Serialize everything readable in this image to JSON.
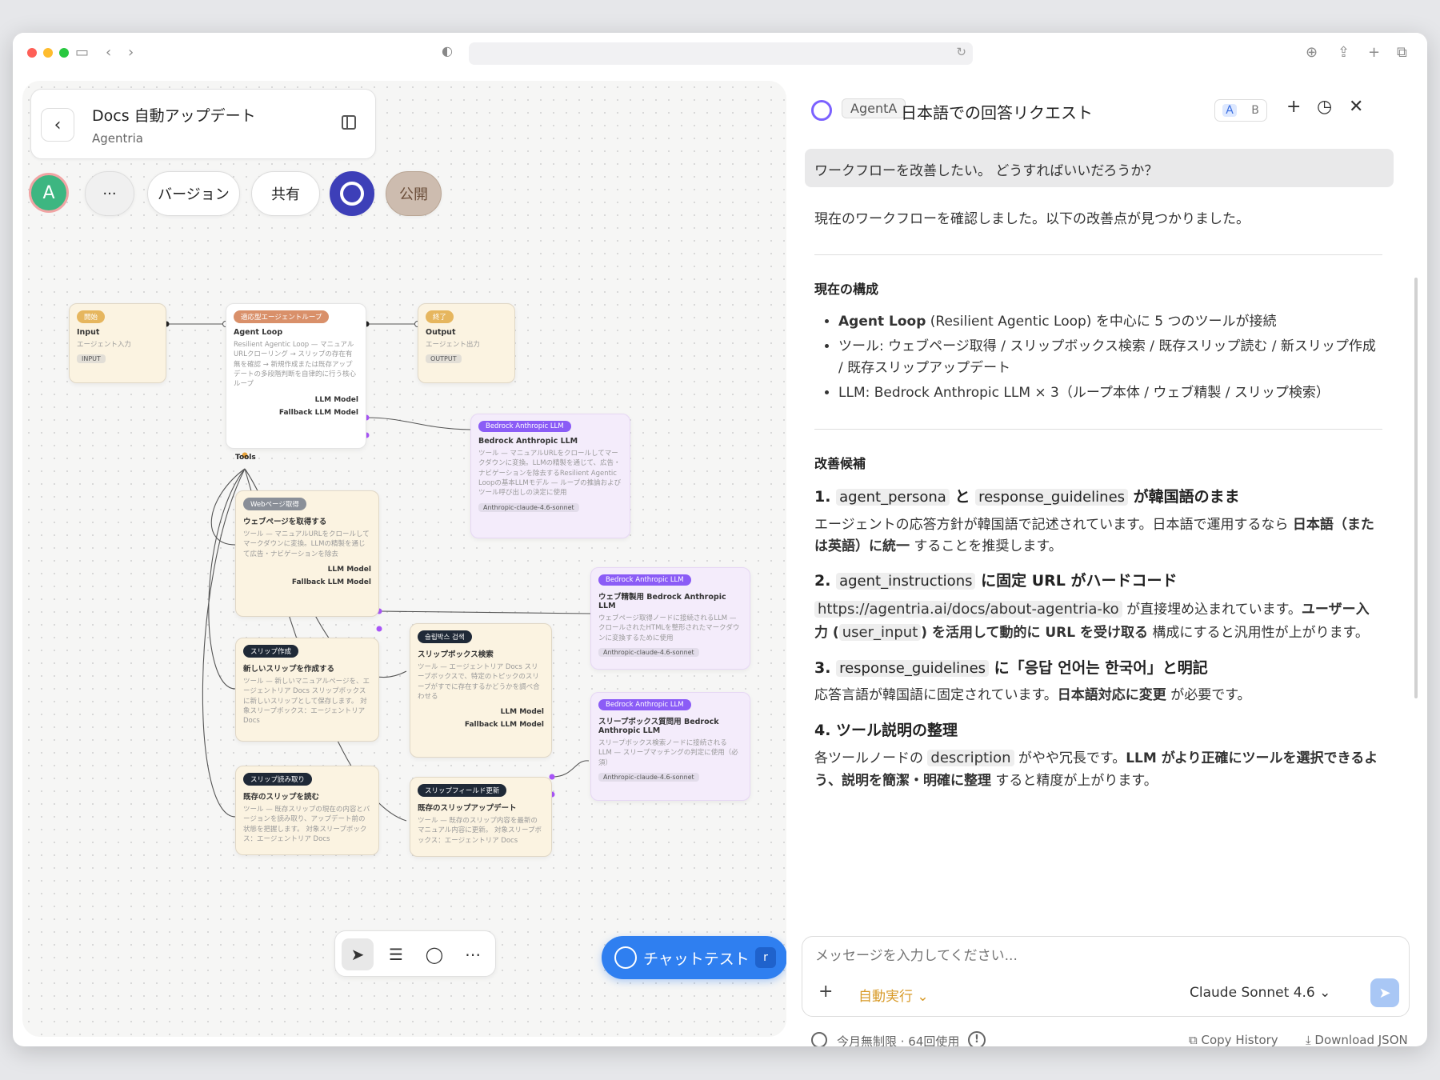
{
  "canvas": {
    "doc_title": "Docs 自動アップデート",
    "doc_subtitle": "Agentria",
    "avatar_letter": "A",
    "more_label": "···",
    "version_label": "バージョン",
    "share_label": "共有",
    "publish_label": "公開",
    "nodes": {
      "input": {
        "tag": "開始",
        "title": "Input",
        "desc": "エージェント入力",
        "badge": "INPUT"
      },
      "agent": {
        "tag": "適応型エージェントループ",
        "title": "Agent Loop",
        "desc": "Resilient Agentic Loop — マニュアルURLクローリング → スリップの存在有無を確認 → 新規作成または既存アップデートの多段階判断を自律的に行う核心ループ",
        "llm": "LLM Model",
        "fallback": "Fallback LLM Model",
        "tools": "Tools"
      },
      "output": {
        "tag": "終了",
        "title": "Output",
        "desc": "エージェント出力",
        "badge": "OUTPUT"
      },
      "llm1": {
        "tag": "Bedrock Anthropic LLM",
        "title": "Bedrock Anthropic LLM",
        "desc": "ツール — マニュアルURLをクロールしてマークダウンに変換。LLMの精製を通じて、広告・ナビゲーションを除去するResilient Agentic Loopの基本LLMモデル — ループの推論およびツール呼び出しの決定に使用",
        "badge": "Anthropic-claude-4.6-sonnet"
      },
      "web": {
        "tag": "Webページ取得",
        "title": "ウェブページを取得する",
        "desc": "ツール — マニュアルURLをクロールしてマークダウンに変換。LLMの精製を通じて広告・ナビゲーションを除去",
        "llm": "LLM Model",
        "fallback": "Fallback LLM Model"
      },
      "llm2": {
        "tag": "Bedrock Anthropic LLM",
        "title": "ウェブ精製用 Bedrock Anthropic LLM",
        "desc": "ウェブページ取得ノードに接続されるLLM — クロールされたHTMLを整形されたマークダウンに変換するために使用",
        "badge": "Anthropic-claude-4.6-sonnet"
      },
      "create": {
        "tag": "スリップ作成",
        "title": "新しいスリップを作成する",
        "desc": "ツール — 新しいマニュアルページを、エージェントリア Docs スリップボックスに新しいスリップとして保存します。 対象スリープボックス：エージェントリア Docs"
      },
      "search": {
        "tag": "슬립박스 검색",
        "title": "スリップボックス検索",
        "desc": "ツール — エージェントリア Docs スリープボックスで、特定のトピックのスリープがすでに存在するかどうかを調べ合わせる",
        "llm": "LLM Model",
        "fallback": "Fallback LLM Model"
      },
      "llm3": {
        "tag": "Bedrock Anthropic LLM",
        "title": "スリープボックス質問用 Bedrock Anthropic LLM",
        "desc": "スリープボックス検索ノードに接続される LLM — スリープマッチングの判定に使用（必須）",
        "badge": "Anthropic-claude-4.6-sonnet"
      },
      "read": {
        "tag": "スリップ読み取り",
        "title": "既存のスリップを読む",
        "desc": "ツール — 既存スリップの現在の内容とバージョンを読み取り、アップデート前の状態を把握します。 対象スリープボックス：エージェントリア Docs"
      },
      "update": {
        "tag": "スリップフィールド更新",
        "title": "既存のスリップアップデート",
        "desc": "ツール — 既存のスリップ内容を最新のマニュアル内容に更新。 対象スリープボックス：エージェントリア Docs"
      }
    },
    "chat_test_label": "チャットテスト",
    "chat_test_key": "r"
  },
  "chat": {
    "agent_chip": "AgentA",
    "title": "日本語での回答リクエスト",
    "ab_a": "A",
    "ab_b": "B",
    "user_message": "ワークフローを改善したい。 どうすればいいだろうか？",
    "intro": "現在のワークフローを確認しました。以下の改善点が見つかりました。",
    "section1_heading": "現在の構成",
    "bullet1_bold": "Agent Loop",
    "bullet1_rest": " (Resilient Agentic Loop) を中心に 5 つのツールが接続",
    "bullet2": "ツール: ウェブページ取得 / スリップボックス検索 / 既存スリップ読む / 新スリップ作成 / 既存スリップアップデート",
    "bullet3": "LLM: Bedrock Anthropic LLM × 3（ループ本体 / ウェブ精製 / スリップ検索）",
    "section2_heading": "改善候補",
    "item1": {
      "num": "1.",
      "code_a": "agent_persona",
      "mid": "と",
      "code_b": "response_guidelines",
      "tail": "が韓国語のまま",
      "body_a": "エージェントの応答方針が韓国語で記述されています。日本語で運用するなら ",
      "body_bold": "日本語（または英語）に統一",
      "body_b": " することを推奨します。"
    },
    "item2": {
      "num": "2.",
      "code": "agent_instructions",
      "tail": "に固定 URL がハードコード",
      "url": "https://agentria.ai/docs/about-agentria-ko",
      "body_a": " が直接埋め込まれています。",
      "body_bold_a": "ユーザー入力 (",
      "code_in": "user_input",
      "body_bold_b": ") を活用して動的に URL を受け取る",
      "body_b": " 構成にすると汎用性が上がります。"
    },
    "item3": {
      "num": "3.",
      "code": "response_guidelines",
      "tail": "に「응답 언어는 한국어」と明記",
      "body_a": "応答言語が韓国語に固定されています。",
      "body_bold": "日本語対応に変更",
      "body_b": " が必要です。"
    },
    "item4": {
      "heading": "4. ツール説明の整理",
      "body_a": "各ツールノードの ",
      "code": "description",
      "body_b": " がやや冗長です。",
      "body_bold": "LLM がより正確にツールを選択できるよう、説明を簡潔・明確に整理",
      "body_c": " すると精度が上がります。"
    },
    "input_placeholder": "メッセージを入力してください...",
    "auto_run_label": "自動実行",
    "model_label": "Claude Sonnet 4.6",
    "usage_label": "今月無制限 · 64回使用",
    "copy_history_label": "Copy History",
    "download_json_label": "Download JSON"
  },
  "colors": {
    "accent": "#2f7ff0",
    "auto_run": "#d89b2a",
    "agent_logo": "#7b61ff"
  }
}
